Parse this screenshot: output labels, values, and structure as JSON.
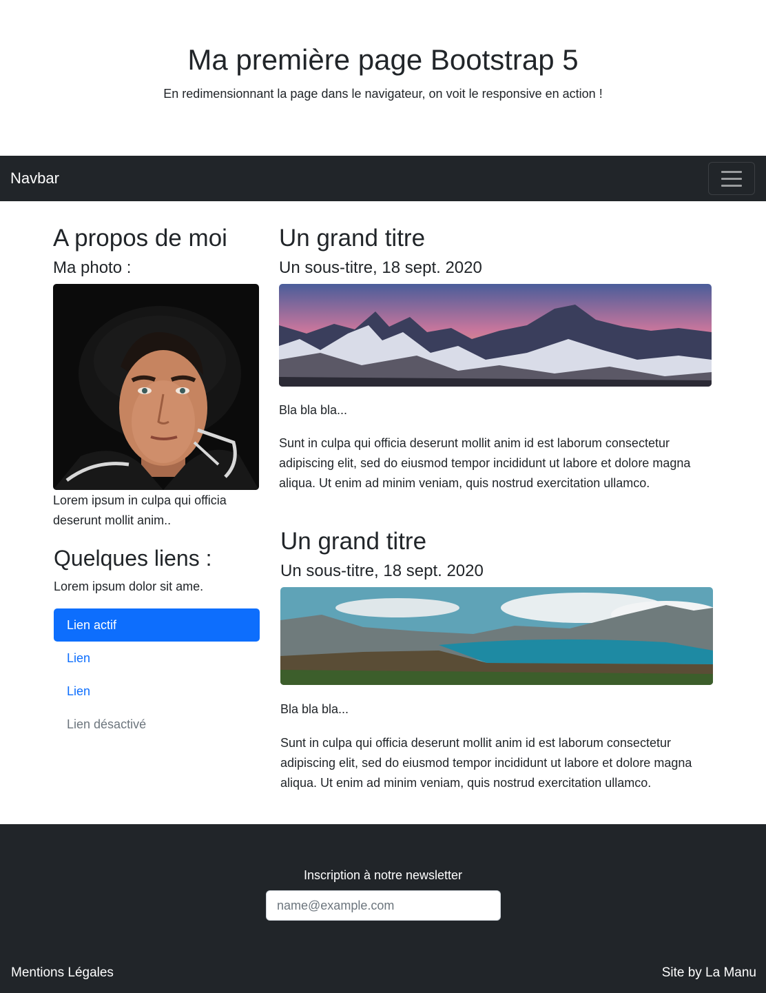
{
  "header": {
    "title": "Ma première page Bootstrap 5",
    "subtitle": "En redimensionnant la page dans le navigateur, on voit le responsive en action !"
  },
  "navbar": {
    "brand": "Navbar",
    "toggler_icon": "hamburger-menu-icon"
  },
  "sidebar": {
    "about_title": "A propos de moi",
    "photo_label": "Ma photo :",
    "photo_caption": "Lorem ipsum in culpa qui officia deserunt mollit anim..",
    "links_title": "Quelques liens :",
    "links_text": "Lorem ipsum dolor sit ame.",
    "links": [
      {
        "label": "Lien actif",
        "state": "active"
      },
      {
        "label": "Lien",
        "state": "normal"
      },
      {
        "label": "Lien",
        "state": "normal"
      },
      {
        "label": "Lien désactivé",
        "state": "disabled"
      }
    ]
  },
  "articles": [
    {
      "title": "Un grand titre",
      "subtitle": "Un sous-titre, 18 sept. 2020",
      "short": "Bla bla bla...",
      "body": "Sunt in culpa qui officia deserunt mollit anim id est laborum consectetur adipiscing elit, sed do eiusmod tempor incididunt ut labore et dolore magna aliqua. Ut enim ad minim veniam, quis nostrud exercitation ullamco."
    },
    {
      "title": "Un grand titre",
      "subtitle": "Un sous-titre, 18 sept. 2020",
      "short": "Bla bla bla...",
      "body": "Sunt in culpa qui officia deserunt mollit anim id est laborum consectetur adipiscing elit, sed do eiusmod tempor incididunt ut labore et dolore magna aliqua. Ut enim ad minim veniam, quis nostrud exercitation ullamco."
    }
  ],
  "footer": {
    "newsletter_label": "Inscription à notre newsletter",
    "newsletter_placeholder": "name@example.com",
    "legal": "Mentions Légales",
    "credit": "Site by La Manu"
  },
  "colors": {
    "dark": "#212529",
    "primary": "#0d6efd",
    "muted": "#6c757d"
  }
}
